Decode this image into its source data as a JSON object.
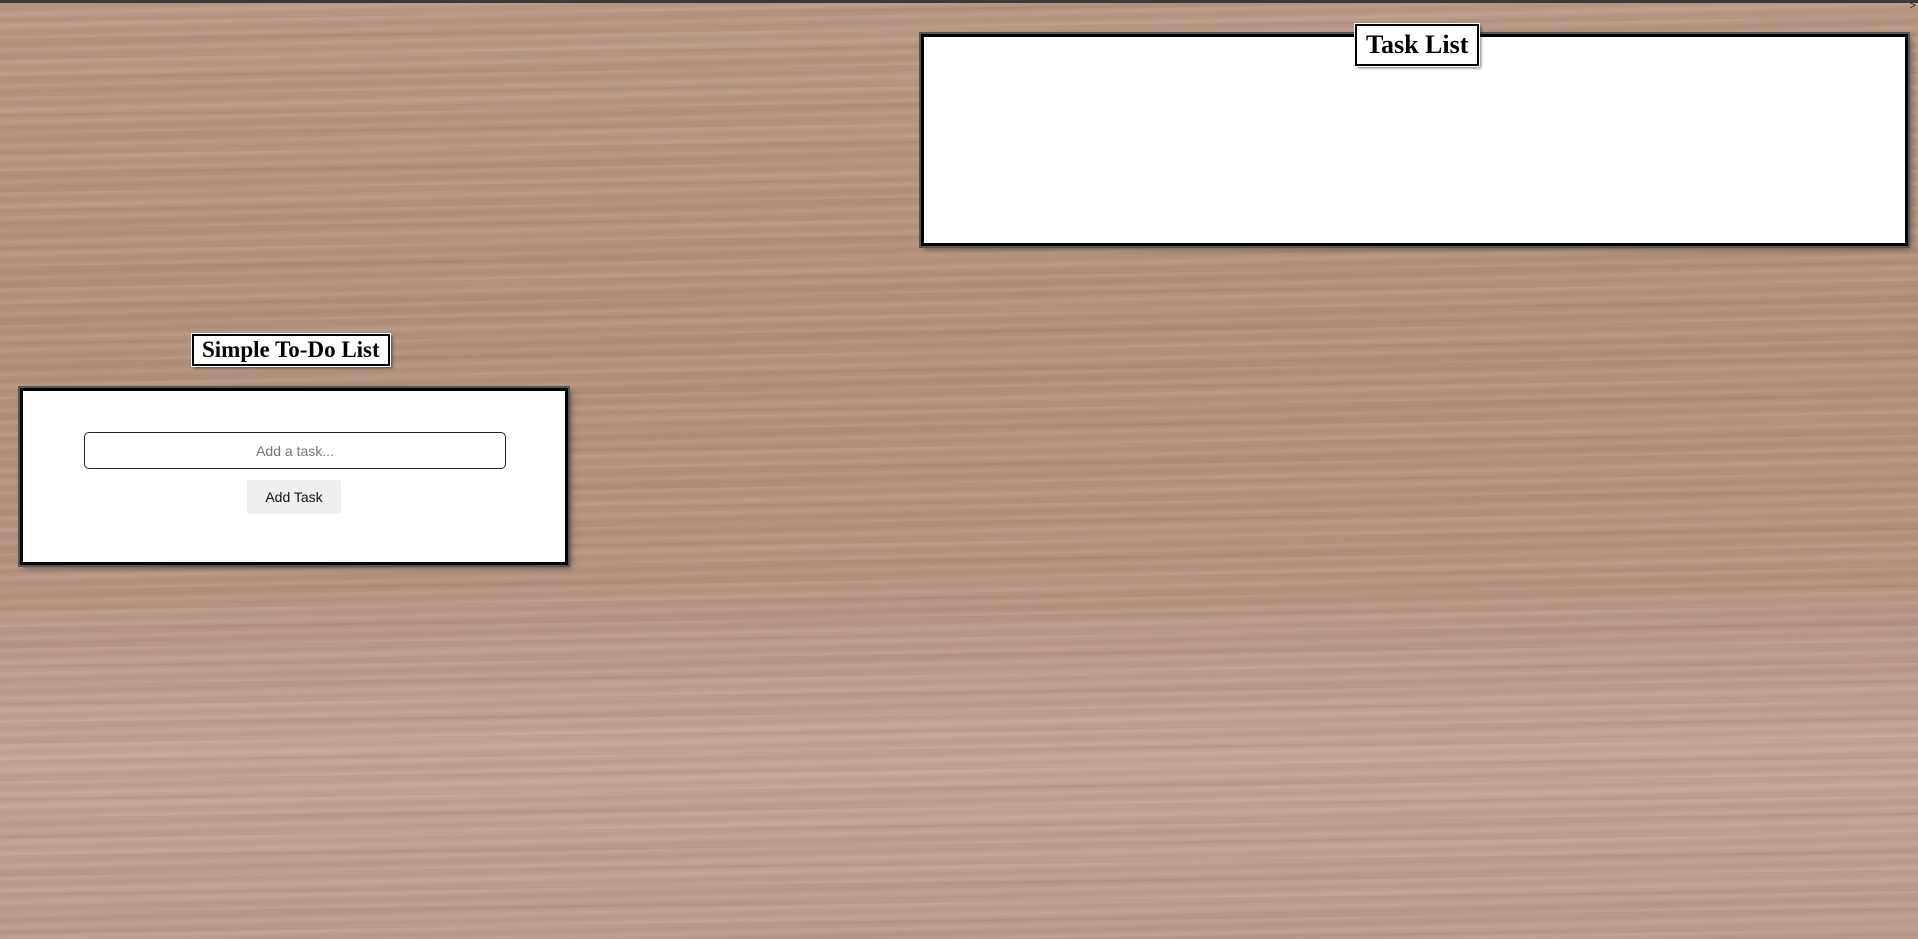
{
  "app": {
    "corner_glyph": ">"
  },
  "todo": {
    "title": "Simple To-Do List",
    "input_value": "",
    "input_placeholder": "Add a task...",
    "add_button_label": "Add Task"
  },
  "tasks": {
    "title": "Task List",
    "items": []
  }
}
